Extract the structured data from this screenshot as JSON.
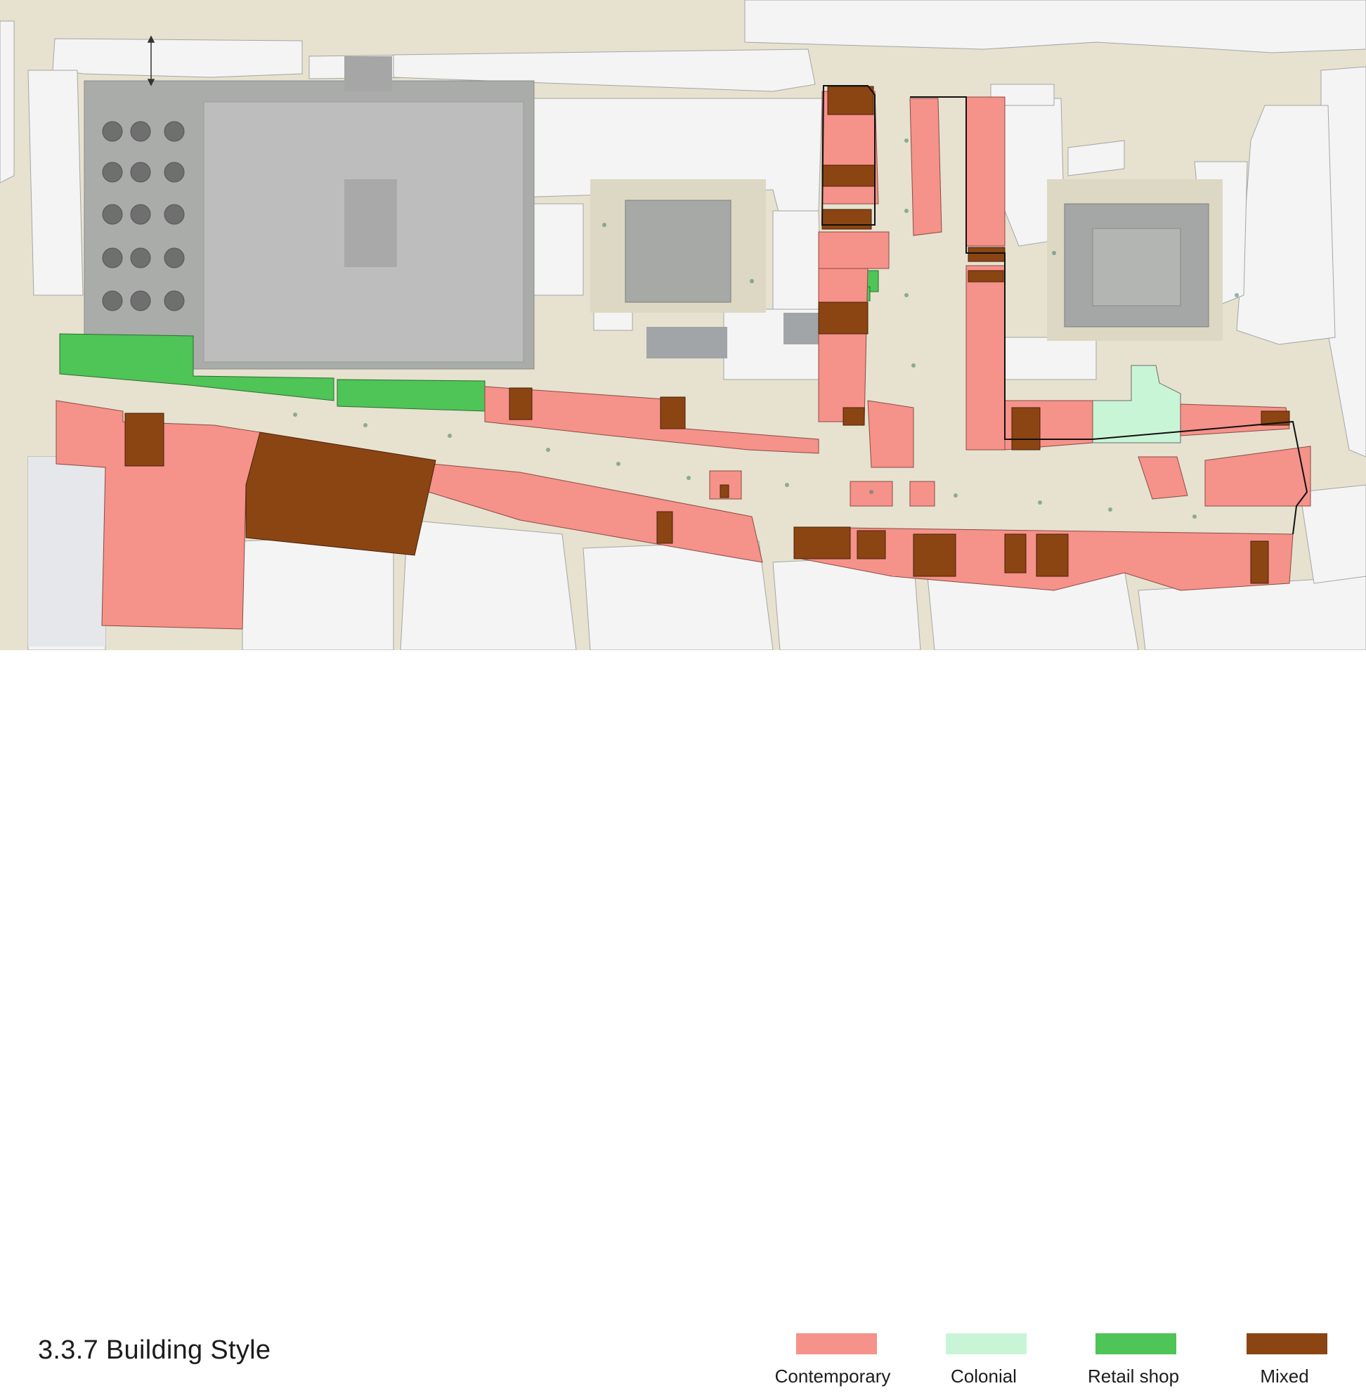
{
  "title": "3.3.7   Building Style",
  "legend": {
    "contemporary": {
      "label": "Contemporary",
      "color": "#f5928a"
    },
    "colonial": {
      "label": "Colonial",
      "color": "#c9f5d7"
    },
    "retail": {
      "label": "Retail shop",
      "color": "#4fc457"
    },
    "mixed": {
      "label": "Mixed",
      "color": "#8b4513"
    }
  },
  "map_colors": {
    "background": "#e6e2cf",
    "building": "#f4f4f4",
    "building_outline": "#9a9a9a",
    "courtyard": "#bdbdbd",
    "temple": "#a9aca9",
    "outline": "#111111"
  }
}
